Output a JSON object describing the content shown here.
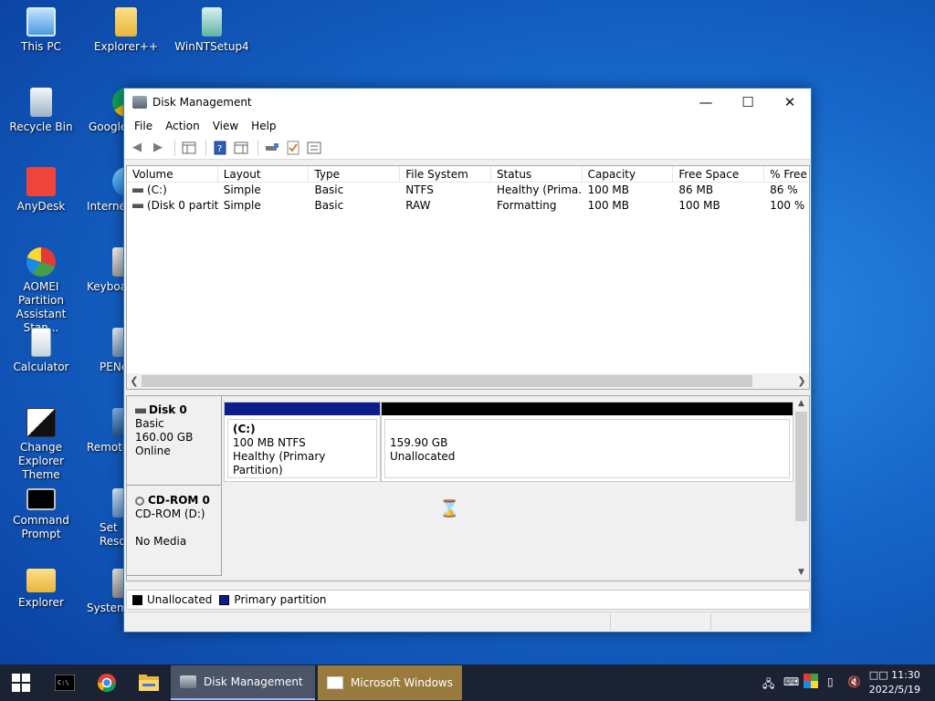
{
  "desktop": {
    "icons": [
      {
        "label": "This PC"
      },
      {
        "label": "Explorer++"
      },
      {
        "label": "WinNTSetup4"
      },
      {
        "label": "Recycle Bin"
      },
      {
        "label": "Google"
      },
      {
        "label": "AnyDesk"
      },
      {
        "label": "Internet"
      },
      {
        "label": "AOMEI Partition Assistant Stan..."
      },
      {
        "label": "Keyboa"
      },
      {
        "label": "Calculator"
      },
      {
        "label": "PENe"
      },
      {
        "label": "Change Explorer Theme"
      },
      {
        "label": "Remote"
      },
      {
        "label": "Command Prompt"
      },
      {
        "label": "Set Reso"
      },
      {
        "label": "Explorer"
      },
      {
        "label": "System"
      }
    ]
  },
  "window": {
    "title": "Disk Management",
    "minimize": "—",
    "maximize": "☐",
    "close": "✕"
  },
  "menu": [
    "File",
    "Action",
    "View",
    "Help"
  ],
  "list": {
    "columns": [
      "Volume",
      "Layout",
      "Type",
      "File System",
      "Status",
      "Capacity",
      "Free Space",
      "% Free"
    ],
    "rows": [
      [
        "(C:)",
        "Simple",
        "Basic",
        "NTFS",
        "Healthy (Prima...",
        "100 MB",
        "86 MB",
        "86 %"
      ],
      [
        "(Disk 0 partiti...",
        "Simple",
        "Basic",
        "RAW",
        "Formatting",
        "100 MB",
        "100 MB",
        "100 %"
      ]
    ]
  },
  "disks": [
    {
      "name": "Disk 0",
      "type": "Basic",
      "size": "160.00 GB",
      "status": "Online",
      "partitions": [
        {
          "line1": "(C:)",
          "line2": "100 MB NTFS",
          "line3": "Healthy (Primary Partition)",
          "bar_color": "#0b1e8c"
        },
        {
          "line1": "",
          "line2": "159.90 GB",
          "line3": "Unallocated",
          "bar_color": "#000000"
        }
      ]
    },
    {
      "name": "CD-ROM 0",
      "drive": "CD-ROM (D:)",
      "media": "No Media"
    }
  ],
  "legend": [
    {
      "label": "Unallocated",
      "color": "#000000"
    },
    {
      "label": "Primary partition",
      "color": "#0b1e8c"
    }
  ],
  "taskbar": {
    "buttons": [
      {
        "label": "Disk Management"
      },
      {
        "label": "Microsoft Windows"
      }
    ],
    "time": "11:30",
    "date": "2022/5/19",
    "ime": "□□"
  }
}
